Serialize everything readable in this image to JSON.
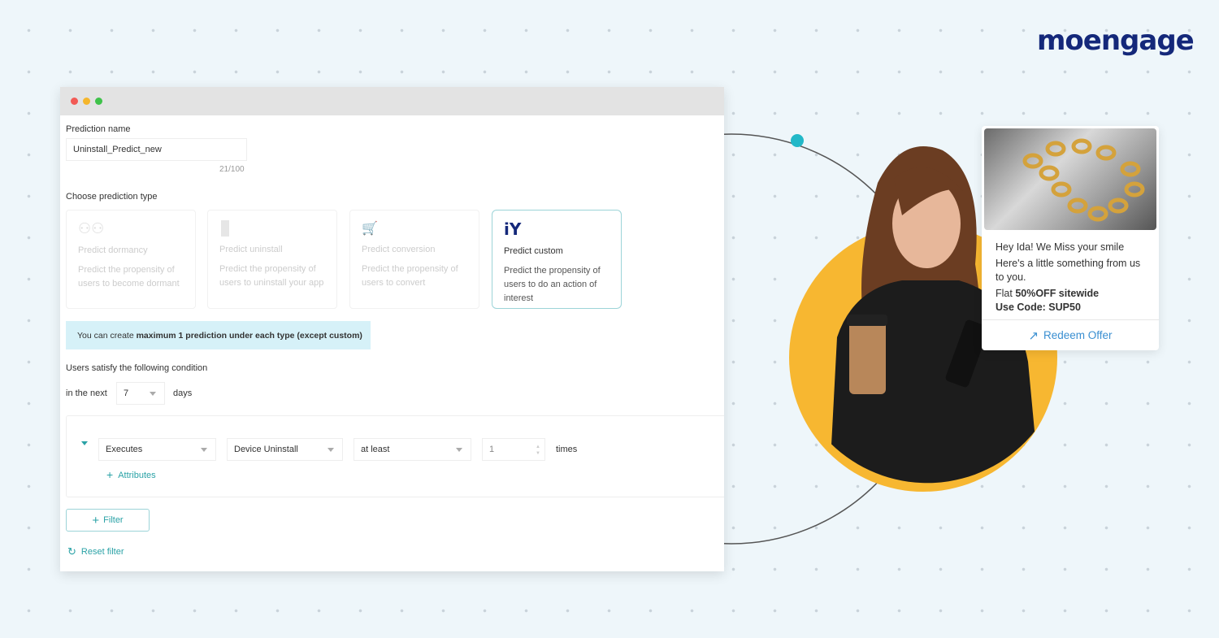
{
  "brand": {
    "logo": "moengage",
    "colors": {
      "teal": "#2aa2a6",
      "navy": "#14287a",
      "yellow": "#f7b731"
    }
  },
  "window": {
    "controls": [
      "close",
      "minimize",
      "maximize"
    ]
  },
  "form": {
    "name_label": "Prediction name",
    "name_value": "Uninstall_Predict_new",
    "name_counter": "21/100",
    "type_label": "Choose prediction type",
    "types": [
      {
        "icon": "people-icon",
        "title": "Predict dormancy",
        "desc": "Predict the propensity of users to become dormant",
        "selected": false
      },
      {
        "icon": "trash-icon",
        "title": "Predict uninstall",
        "desc": "Predict the propensity of users to uninstall your app",
        "selected": false
      },
      {
        "icon": "cart-icon",
        "title": "Predict conversion",
        "desc": "Predict the propensity of users to convert",
        "selected": false
      },
      {
        "icon": "tools-icon",
        "title": "Predict custom",
        "desc": "Predict the propensity of users to do an action of interest",
        "selected": true
      }
    ],
    "info_pre": "You can create ",
    "info_bold": "maximum 1 prediction under each type (except custom)",
    "condition_label": "Users satisfy the following condition",
    "in_next": "in the next",
    "days_value": "7",
    "days": "days",
    "condition": {
      "action": "Executes",
      "event": "Device Uninstall",
      "operator": "at least",
      "count": "1",
      "times": "times",
      "attributes": "Attributes"
    },
    "filter": "Filter",
    "reset": "Reset filter"
  },
  "notification": {
    "line1": "Hey Ida! We Miss your smile",
    "line2": "Here's a little something from us to you.",
    "flat": "Flat ",
    "offer": "50%OFF sitewide",
    "code": "Use Code: SUP50",
    "cta": "Redeem Offer"
  }
}
